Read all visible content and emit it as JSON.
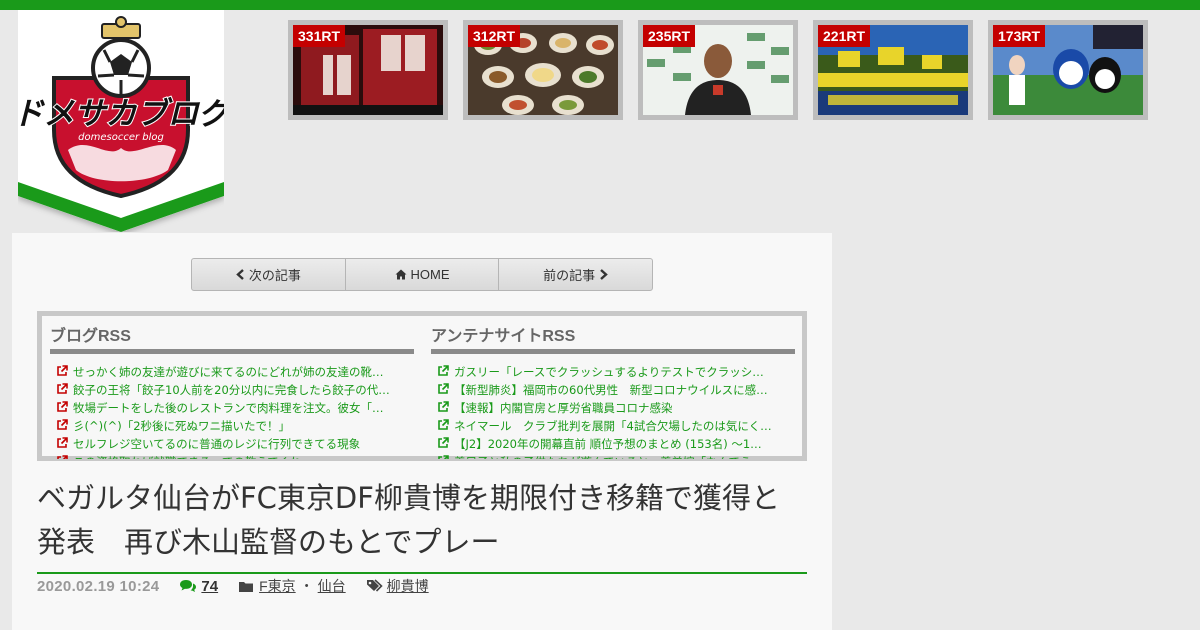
{
  "logo": {
    "title_text": "ドメサカブログ",
    "subtitle_text": "domesoccer blog"
  },
  "thumbnails": [
    {
      "rt": "331RT",
      "icon": "jersey-photo"
    },
    {
      "rt": "312RT",
      "icon": "food-photo"
    },
    {
      "rt": "235RT",
      "icon": "interview-photo"
    },
    {
      "rt": "221RT",
      "icon": "supporters-photo"
    },
    {
      "rt": "173RT",
      "icon": "mascot-photo"
    }
  ],
  "pager": {
    "next_label": "次の記事",
    "home_label": "HOME",
    "prev_label": "前の記事"
  },
  "rss": {
    "blog": {
      "heading": "ブログRSS",
      "items": [
        "せっかく姉の友達が遊びに来てるのにどれが姉の友達の靴…",
        "餃子の王将「餃子10人前を20分以内に完食したら餃子の代…",
        "牧場デートをした後のレストランで肉料理を注文。彼女「…",
        "彡(^)(^)「2秒後に死ぬワニ描いたで！」",
        "セルフレジ空いてるのに普通のレジに行列できてる現象",
        "この資格取れば就職できるっての教えてくれ"
      ]
    },
    "antenna": {
      "heading": "アンテナサイトRSS",
      "items": [
        "ガスリー「レースでクラッシュするよりテストでクラッシ…",
        "【新型肺炎】福岡市の60代男性　新型コロナウイルスに感…",
        "【速報】内閣官房と厚労省職員コロナ感染",
        "ネイマール　クラブ批判を展開「4試合欠場したのは気にく…",
        "【J2】2020年の開幕直前 順位予想のまとめ (153名) ～1…",
        "義兄子と私の子供たちが遊んでいると、義弟嫁「なんでう…"
      ]
    }
  },
  "article": {
    "title": "ベガルタ仙台がFC東京DF柳貴博を期限付き移籍で獲得と発表　再び木山監督のもとでプレー",
    "date": "2020.02.19 10:24",
    "comments": "74",
    "categories": [
      "F東京",
      "仙台"
    ],
    "category_sep": "・",
    "tag": "柳貴博"
  },
  "colors": {
    "accent_green": "#1a9a1a",
    "rt_badge_red": "#c40000",
    "logo_red": "#c8102e"
  }
}
